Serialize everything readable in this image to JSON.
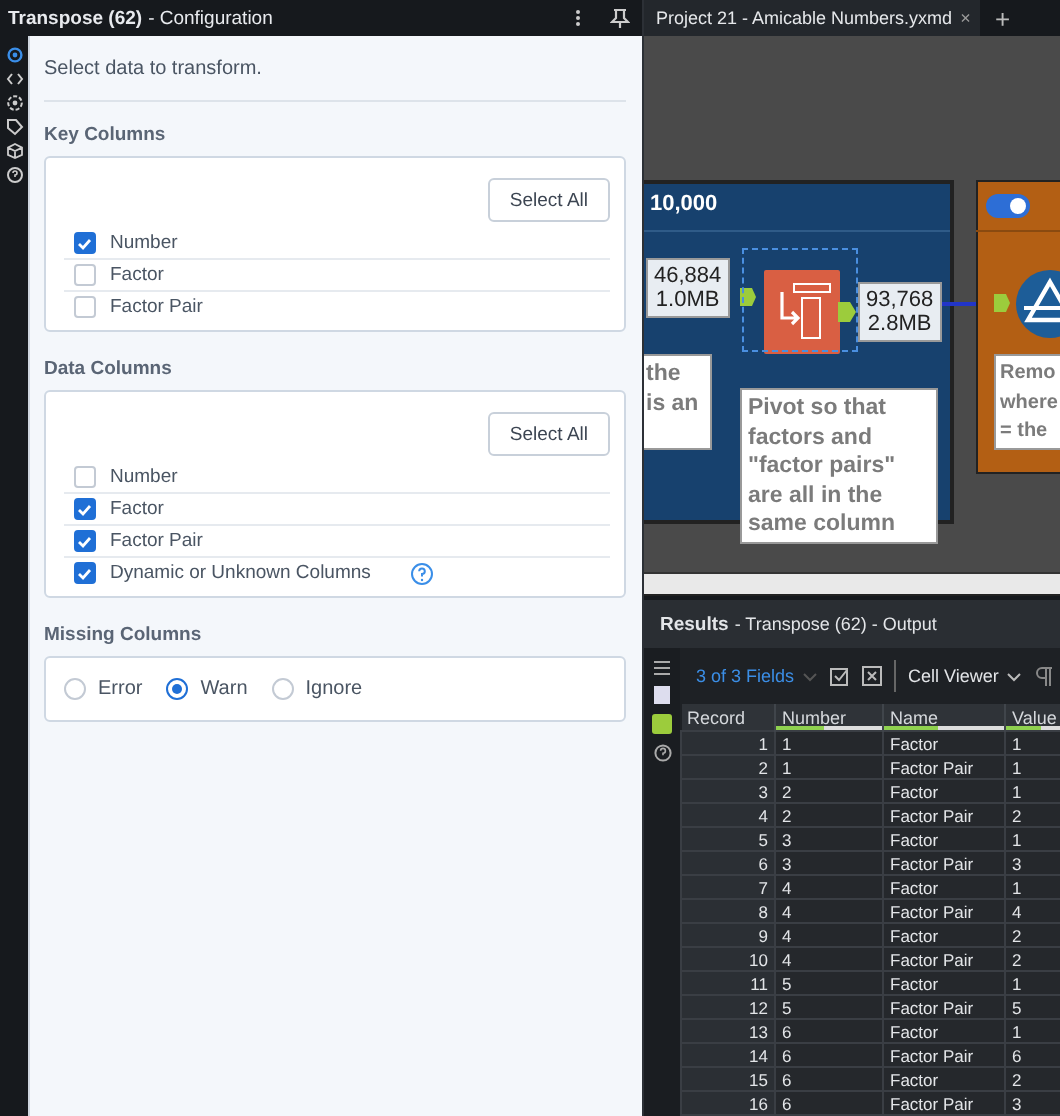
{
  "config": {
    "title": "Transpose (62)",
    "subtitle": "- Configuration",
    "prompt": "Select data to transform.",
    "key_columns": {
      "heading": "Key Columns",
      "button": "Select All",
      "items": [
        {
          "label": "Number",
          "checked": true,
          "has_help": false
        },
        {
          "label": "Factor",
          "checked": false,
          "has_help": false
        },
        {
          "label": "Factor Pair",
          "checked": false,
          "has_help": false
        }
      ]
    },
    "data_columns": {
      "heading": "Data Columns",
      "button": "Select All",
      "items": [
        {
          "label": "Number",
          "checked": false,
          "has_help": false
        },
        {
          "label": "Factor",
          "checked": true,
          "has_help": false
        },
        {
          "label": "Factor Pair",
          "checked": true,
          "has_help": false
        },
        {
          "label": "Dynamic or Unknown Columns",
          "checked": true,
          "has_help": true
        }
      ]
    },
    "missing_columns": {
      "heading": "Missing Columns",
      "options": [
        {
          "label": "Error",
          "selected": false
        },
        {
          "label": "Warn",
          "selected": true
        },
        {
          "label": "Ignore",
          "selected": false
        }
      ]
    }
  },
  "workflow": {
    "tab": "Project 21 - Amicable Numbers.yxmd",
    "tab_close": "×",
    "new_tab": "+",
    "container_title": "10,000",
    "container_toggle_on": true,
    "input_badge": [
      "46,884",
      "1.0MB"
    ],
    "output_badge": [
      "93,768",
      "2.8MB"
    ],
    "left_comment": [
      "the",
      "is an"
    ],
    "pivot_comment": "Pivot so that factors and \"factor pairs\" are all in the same column",
    "right_comment": [
      "Remo",
      "where",
      "= the"
    ]
  },
  "results": {
    "title": "Results",
    "subtitle": "- Transpose (62) - Output",
    "fields": "3 of 3 Fields",
    "viewer": "Cell Viewer",
    "columns": [
      "Record",
      "Number",
      "Name",
      "Value"
    ],
    "rows": [
      [
        "1",
        "1",
        "Factor",
        "1"
      ],
      [
        "2",
        "1",
        "Factor Pair",
        "1"
      ],
      [
        "3",
        "2",
        "Factor",
        "1"
      ],
      [
        "4",
        "2",
        "Factor Pair",
        "2"
      ],
      [
        "5",
        "3",
        "Factor",
        "1"
      ],
      [
        "6",
        "3",
        "Factor Pair",
        "3"
      ],
      [
        "7",
        "4",
        "Factor",
        "1"
      ],
      [
        "8",
        "4",
        "Factor Pair",
        "4"
      ],
      [
        "9",
        "4",
        "Factor",
        "2"
      ],
      [
        "10",
        "4",
        "Factor Pair",
        "2"
      ],
      [
        "11",
        "5",
        "Factor",
        "1"
      ],
      [
        "12",
        "5",
        "Factor Pair",
        "5"
      ],
      [
        "13",
        "6",
        "Factor",
        "1"
      ],
      [
        "14",
        "6",
        "Factor Pair",
        "6"
      ],
      [
        "15",
        "6",
        "Factor",
        "2"
      ],
      [
        "16",
        "6",
        "Factor Pair",
        "3"
      ]
    ]
  }
}
